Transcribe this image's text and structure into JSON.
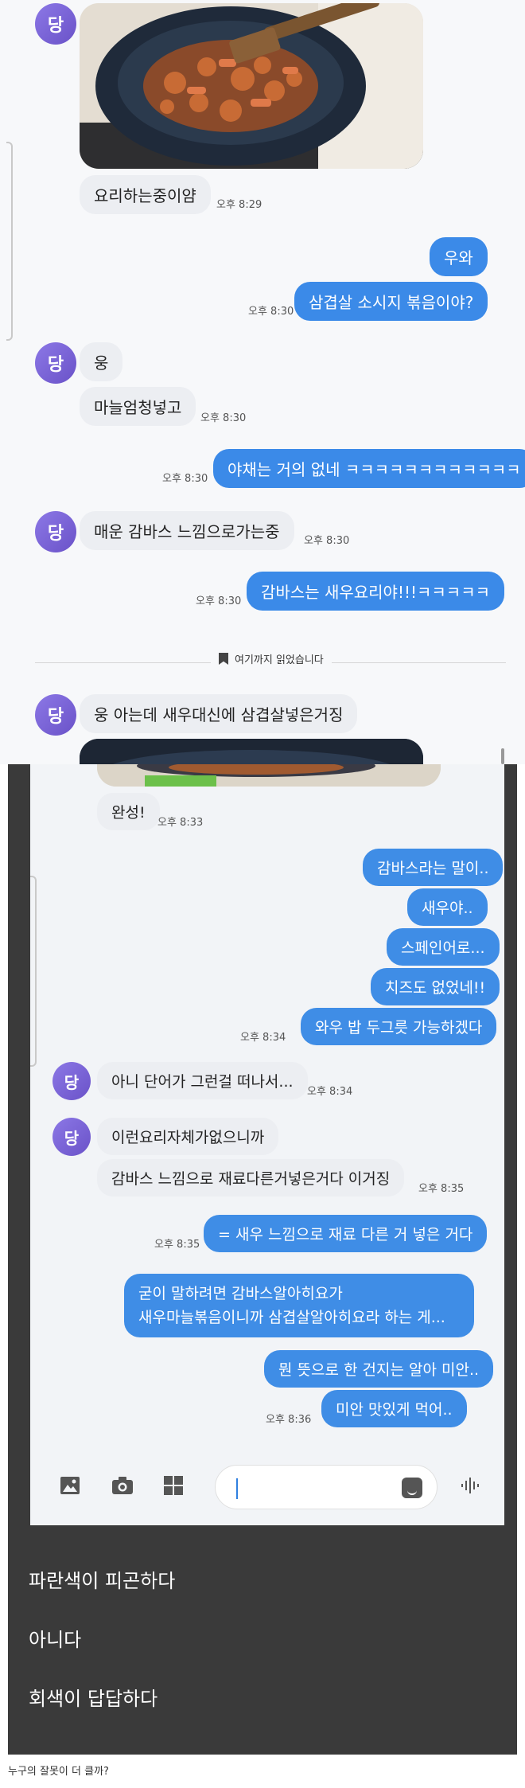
{
  "top_chat": {
    "avatar_label": "당",
    "messages": [
      {
        "text": "요리하는중이얌",
        "time": "오후 8:29"
      },
      {
        "text": "우와"
      },
      {
        "text": "삼겹살 소시지 볶음이야?",
        "time": "오후 8:30"
      },
      {
        "text": "웅"
      },
      {
        "text": "마늘엄청넣고",
        "time": "오후 8:30"
      },
      {
        "text": "야채는 거의 없네 ㅋㅋㅋㅋㅋㅋㅋㅋㅋㅋㅋㅋ",
        "time": "오후 8:30"
      },
      {
        "text": "매운 감바스 느낌으로가는중",
        "time": "오후 8:30"
      },
      {
        "text": "감바스는 새우요리야!!!ㅋㅋㅋㅋㅋ",
        "time": "오후 8:30"
      },
      {
        "text": "웅 아는데 새우대신에 삼겹살넣은거징"
      }
    ],
    "divider_label": "여기까지 읽었습니다"
  },
  "bottom_chat": {
    "avatar_label": "당",
    "messages": [
      {
        "text": "완성!",
        "time": "오후 8:33"
      },
      {
        "text": "감바스라는 말이.."
      },
      {
        "text": "새우야.."
      },
      {
        "text": "스페인어로..."
      },
      {
        "text": "치즈도 없었네!!"
      },
      {
        "text": "와우 밥 두그릇 가능하겠다",
        "time": "오후 8:34"
      },
      {
        "text": "아니 단어가  그런걸 떠나서...",
        "time": "오후 8:34"
      },
      {
        "text": "이런요리자체가없으니까"
      },
      {
        "text": "감바스  느낌으로 재료다른거넣은거다 이거징",
        "time": "오후 8:35"
      },
      {
        "text": "= 새우 느낌으로 재료 다른 거 넣은 거다",
        "time": "오후 8:35"
      },
      {
        "text_line1": "굳이 말하려면 감바스알아히요가",
        "text_line2": "새우마늘볶음이니까 삼겹살알아히요라 하는 게..."
      },
      {
        "text": "뭔 뜻으로 한 건지는 알아 미안.."
      },
      {
        "text": "미안 맛있게 먹어..",
        "time": "오후 8:36"
      }
    ]
  },
  "poll_options": [
    "파란색이 피곤하다",
    "아니다",
    "회색이 답답하다"
  ],
  "caption": "누구의 잘못이 더 클까?",
  "colors": {
    "bubble_out": "#3b8ae8",
    "bubble_in": "#eceef2",
    "avatar": "#7a63d8",
    "dark_panel": "#3a3a3a"
  },
  "icons": [
    "gallery-icon",
    "camera-icon",
    "apps-grid-icon",
    "emoji-sticker-icon",
    "voice-icon",
    "bookmark-icon"
  ]
}
